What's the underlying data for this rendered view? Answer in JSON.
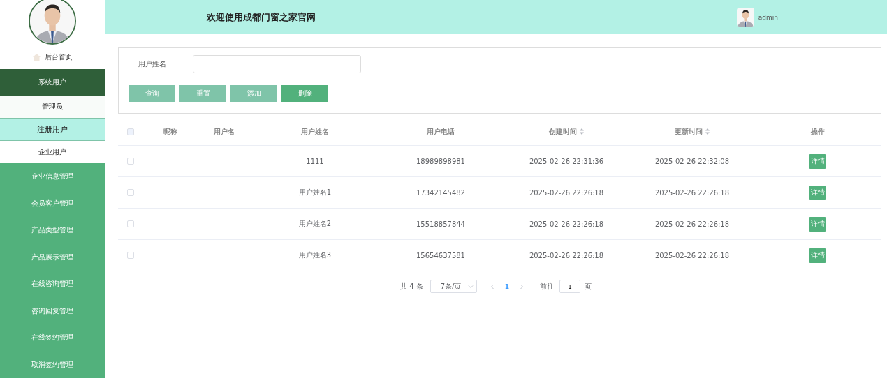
{
  "header": {
    "title": "欢迎使用成都门窗之家官网",
    "user": "admin"
  },
  "sidebar": {
    "home": "后台首页",
    "items": [
      {
        "label": "系统用户",
        "expanded": true,
        "children": [
          {
            "label": "管理员",
            "selected": false
          },
          {
            "label": "注册用户",
            "selected": true
          },
          {
            "label": "企业用户",
            "selected": false
          }
        ]
      },
      {
        "label": "企业信息管理",
        "expanded": false
      },
      {
        "label": "会员客户管理",
        "expanded": false
      },
      {
        "label": "产品类型管理",
        "expanded": false
      },
      {
        "label": "产品展示管理",
        "expanded": false
      },
      {
        "label": "在线咨询管理",
        "expanded": false
      },
      {
        "label": "咨询回复管理",
        "expanded": false
      },
      {
        "label": "在线签约管理",
        "expanded": false
      },
      {
        "label": "取消签约管理",
        "expanded": false
      }
    ]
  },
  "search": {
    "label": "用户姓名",
    "buttons": [
      {
        "label": "查询",
        "kind": "light"
      },
      {
        "label": "重置",
        "kind": "light"
      },
      {
        "label": "添加",
        "kind": "light"
      },
      {
        "label": "删除",
        "kind": "strong"
      }
    ]
  },
  "table": {
    "all_checked": false,
    "columns": [
      {
        "label": "昵称",
        "sortable": false
      },
      {
        "label": "用户名",
        "sortable": false
      },
      {
        "label": "用户姓名",
        "sortable": false
      },
      {
        "label": "用户电话",
        "sortable": false
      },
      {
        "label": "创建时间",
        "sortable": true
      },
      {
        "label": "更新时间",
        "sortable": true
      },
      {
        "label": "操作",
        "sortable": false
      }
    ],
    "rows": [
      {
        "checked": false,
        "cells": [
          "",
          "",
          "1111",
          "18989898981",
          "2025-02-26 22:31:36",
          "2025-02-26 22:32:08"
        ],
        "action": "详情"
      },
      {
        "checked": false,
        "cells": [
          "",
          "",
          "用户姓名1",
          "17342145482",
          "2025-02-26 22:26:18",
          "2025-02-26 22:26:18"
        ],
        "action": "详情"
      },
      {
        "checked": false,
        "cells": [
          "",
          "",
          "用户姓名2",
          "15518857844",
          "2025-02-26 22:26:18",
          "2025-02-26 22:26:18"
        ],
        "action": "详情"
      },
      {
        "checked": false,
        "cells": [
          "",
          "",
          "用户姓名3",
          "15654637581",
          "2025-02-26 22:26:18",
          "2025-02-26 22:26:18"
        ],
        "action": "详情"
      }
    ]
  },
  "pagination": {
    "total": "共 4 条",
    "page_size": "7条/页",
    "pages": [
      {
        "label": "1",
        "selected": true
      }
    ],
    "goto_label": "前往",
    "goto_value": "1",
    "goto_suffix": "页"
  }
}
